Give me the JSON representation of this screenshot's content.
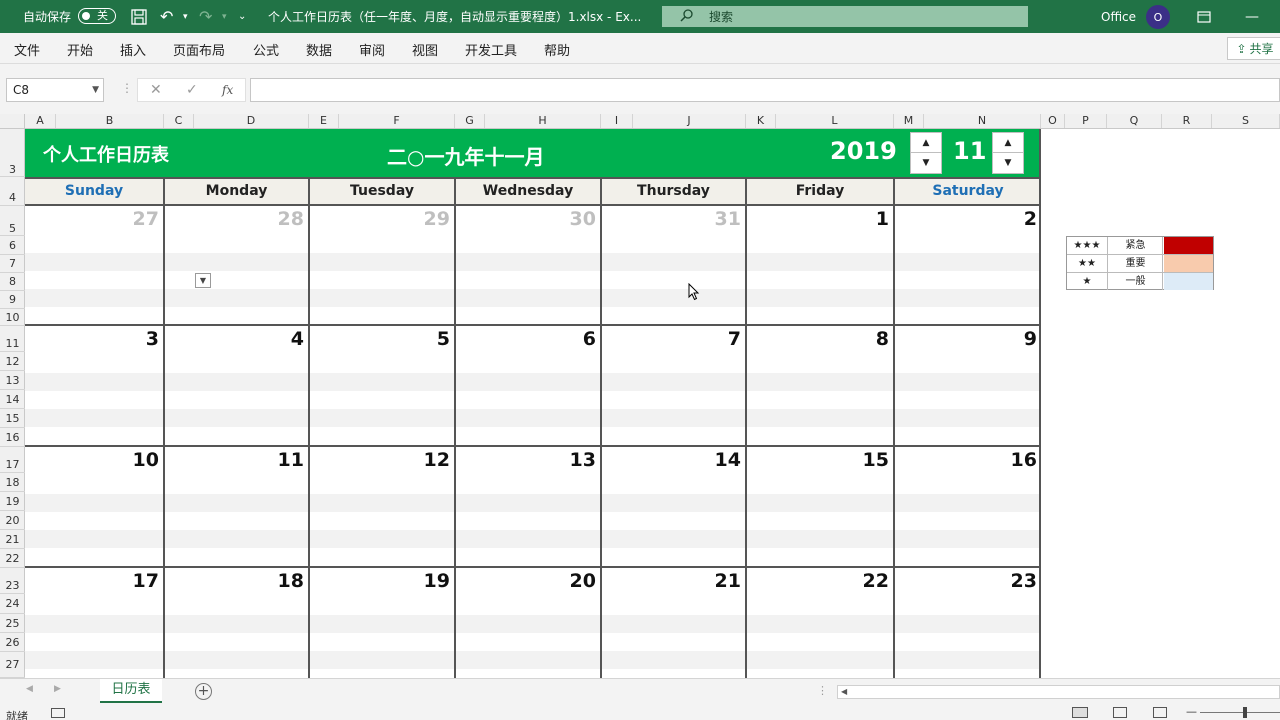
{
  "titlebar": {
    "autosave_label": "自动保存",
    "autosave_state": "关",
    "file_title": "个人工作日历表（任一年度、月度，自动显示重要程度）1.xlsx  -  Ex...",
    "search_placeholder": "搜索",
    "account_name": "Office",
    "avatar_initial": "O"
  },
  "ribbon": {
    "tabs": [
      "文件",
      "开始",
      "插入",
      "页面布局",
      "公式",
      "数据",
      "审阅",
      "视图",
      "开发工具",
      "帮助"
    ],
    "share_label": "共享"
  },
  "formula_bar": {
    "name_box": "C8",
    "fx_label": "fx",
    "formula": ""
  },
  "columns": [
    "A",
    "B",
    "C",
    "D",
    "E",
    "F",
    "G",
    "H",
    "I",
    "J",
    "K",
    "L",
    "M",
    "N",
    "O",
    "P",
    "Q",
    "R",
    "S"
  ],
  "rows": [
    "3",
    "4",
    "5",
    "6",
    "7",
    "8",
    "9",
    "10",
    "11",
    "12",
    "13",
    "14",
    "15",
    "16",
    "17",
    "18",
    "19",
    "20",
    "21",
    "22",
    "23",
    "24",
    "25",
    "26",
    "27"
  ],
  "calendar": {
    "title": "个人工作日历表",
    "month_cn": "二○一九年十一月",
    "year": "2019",
    "month": "11",
    "weekdays": [
      "Sunday",
      "Monday",
      "Tuesday",
      "Wednesday",
      "Thursday",
      "Friday",
      "Saturday"
    ],
    "weeks": [
      [
        {
          "d": "27",
          "other": true
        },
        {
          "d": "28",
          "other": true
        },
        {
          "d": "29",
          "other": true
        },
        {
          "d": "30",
          "other": true
        },
        {
          "d": "31",
          "other": true
        },
        {
          "d": "1",
          "other": false
        },
        {
          "d": "2",
          "other": false
        }
      ],
      [
        {
          "d": "3",
          "other": false
        },
        {
          "d": "4",
          "other": false
        },
        {
          "d": "5",
          "other": false
        },
        {
          "d": "6",
          "other": false
        },
        {
          "d": "7",
          "other": false
        },
        {
          "d": "8",
          "other": false
        },
        {
          "d": "9",
          "other": false
        }
      ],
      [
        {
          "d": "10",
          "other": false
        },
        {
          "d": "11",
          "other": false
        },
        {
          "d": "12",
          "other": false
        },
        {
          "d": "13",
          "other": false
        },
        {
          "d": "14",
          "other": false
        },
        {
          "d": "15",
          "other": false
        },
        {
          "d": "16",
          "other": false
        }
      ],
      [
        {
          "d": "17",
          "other": false
        },
        {
          "d": "18",
          "other": false
        },
        {
          "d": "19",
          "other": false
        },
        {
          "d": "20",
          "other": false
        },
        {
          "d": "21",
          "other": false
        },
        {
          "d": "22",
          "other": false
        },
        {
          "d": "23",
          "other": false
        }
      ]
    ]
  },
  "legend": [
    {
      "stars": "★★★",
      "label": "紧急",
      "color": "#c00000"
    },
    {
      "stars": "★★",
      "label": "重要",
      "color": "#f8cbad"
    },
    {
      "stars": "★",
      "label": "一般",
      "color": "#ddebf7"
    }
  ],
  "sheets": {
    "active": "日历表",
    "add_label": "+"
  },
  "status": {
    "ready": "就绪"
  },
  "colors": {
    "excel_green": "#217346",
    "calendar_green": "#00b050",
    "weekend_blue": "#1f6fb5"
  }
}
